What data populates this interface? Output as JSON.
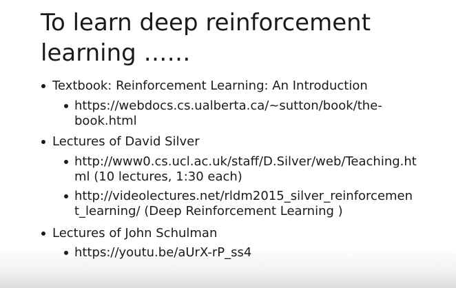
{
  "slide": {
    "title_line1": "To learn deep reinforcement",
    "title_line2": "learning ……",
    "items": [
      {
        "text": "Textbook: Reinforcement Learning: An Introduction",
        "sub": [
          {
            "line1": "https://webdocs.cs.ualberta.ca/~sutton/book/the-",
            "line2": "book.html"
          }
        ]
      },
      {
        "text": "Lectures of David Silver",
        "sub": [
          {
            "line1": "http://www0.cs.ucl.ac.uk/staff/D.Silver/web/Teaching.ht",
            "line2": "ml (10 lectures, 1:30 each)"
          },
          {
            "line1": "http://videolectures.net/rldm2015_silver_reinforcemen",
            "line2": "t_learning/ (Deep Reinforcement Learning )"
          }
        ]
      },
      {
        "text": "Lectures of John Schulman",
        "sub": [
          {
            "line1": "https://youtu.be/aUrX-rP_ss4"
          }
        ]
      }
    ]
  }
}
